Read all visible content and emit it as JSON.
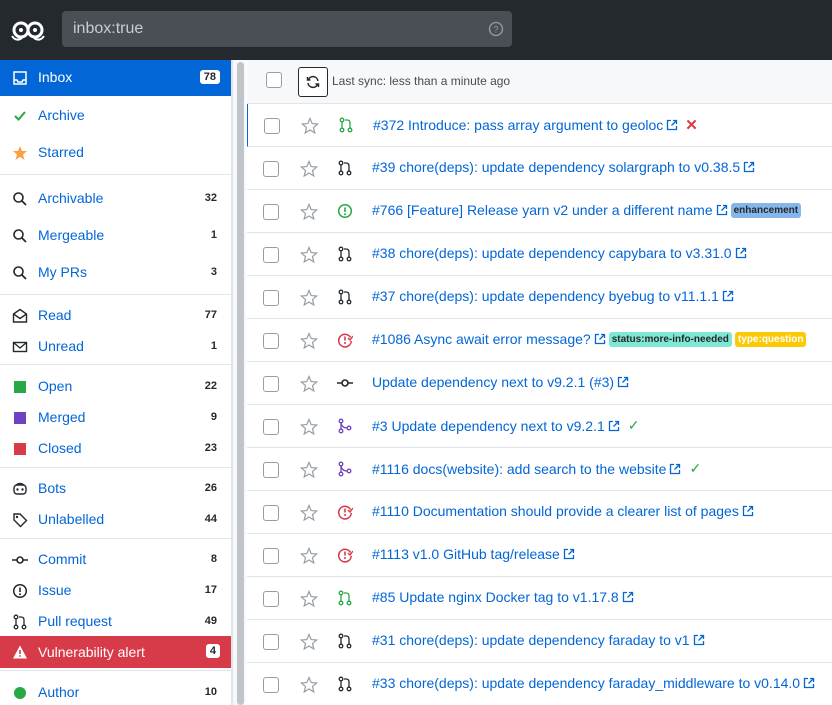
{
  "search": {
    "value": "inbox:true"
  },
  "colors": {
    "primary": "#0366d6",
    "alert": "#d73a49",
    "open": "#28a745",
    "merged": "#6f42c1",
    "closed": "#d73a49",
    "topbar": "#24292e"
  },
  "sidebar": {
    "inbox": {
      "label": "Inbox",
      "count": "78"
    },
    "archive": {
      "label": "Archive"
    },
    "starred": {
      "label": "Starred"
    },
    "archivable": {
      "label": "Archivable",
      "count": "32"
    },
    "mergeable": {
      "label": "Mergeable",
      "count": "1"
    },
    "my_prs": {
      "label": "My PRs",
      "count": "3"
    },
    "read": {
      "label": "Read",
      "count": "77"
    },
    "unread": {
      "label": "Unread",
      "count": "1"
    },
    "open": {
      "label": "Open",
      "count": "22"
    },
    "merged": {
      "label": "Merged",
      "count": "9"
    },
    "closed": {
      "label": "Closed",
      "count": "23"
    },
    "bots": {
      "label": "Bots",
      "count": "26"
    },
    "unlabelled": {
      "label": "Unlabelled",
      "count": "44"
    },
    "commit": {
      "label": "Commit",
      "count": "8"
    },
    "issue": {
      "label": "Issue",
      "count": "17"
    },
    "pull_request": {
      "label": "Pull request",
      "count": "49"
    },
    "vulnerability_alert": {
      "label": "Vulnerability alert",
      "count": "4"
    },
    "author": {
      "label": "Author",
      "count": "10"
    }
  },
  "header": {
    "sync_text": "Last sync: less than a minute ago"
  },
  "notifications": [
    {
      "title": "#372 Introduce: pass array argument to geoloc",
      "type_icon": "pr-open-icon"
    },
    {
      "title": "#39 chore(deps): update dependency solargraph to v0.38.5",
      "type_icon": "pr-icon"
    },
    {
      "title": "#766 [Feature] Release yarn v2 under a different name",
      "type_icon": "issue-open-icon",
      "label": "enhancement"
    },
    {
      "title": "#38 chore(deps): update dependency capybara to v3.31.0",
      "type_icon": "pr-icon"
    },
    {
      "title": "#37 chore(deps): update dependency byebug to v11.1.1",
      "type_icon": "pr-icon"
    },
    {
      "title": "#1086 Async await error message?",
      "type_icon": "issue-closed-icon",
      "labels": [
        "status:more-info-needed",
        "type:question"
      ]
    },
    {
      "title": "Update dependency next to v9.2.1 (#3)",
      "type_icon": "commit-icon"
    },
    {
      "title": "#3 Update dependency next to v9.2.1",
      "type_icon": "pr-merged-icon"
    },
    {
      "title": "#1116 docs(website): add search to the website",
      "type_icon": "pr-merged-icon"
    },
    {
      "title": "#1110 Documentation should provide a clearer list of pages",
      "type_icon": "issue-closed-icon"
    },
    {
      "title": "#1113 v1.0 GitHub tag/release",
      "type_icon": "issue-closed-icon"
    },
    {
      "title": "#85 Update nginx Docker tag to v1.17.8",
      "type_icon": "pr-open-icon"
    },
    {
      "title": "#31 chore(deps): update dependency faraday to v1",
      "type_icon": "pr-icon"
    },
    {
      "title": "#33 chore(deps): update dependency faraday_middleware to v0.14.0",
      "type_icon": "pr-icon"
    }
  ],
  "label_colors": {
    "enhancement": "#84b6eb",
    "status:more-info-needed": "#7ee8d4",
    "type:question": "#fbca04"
  }
}
